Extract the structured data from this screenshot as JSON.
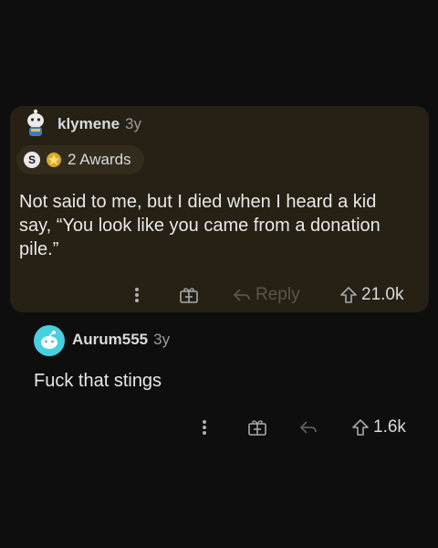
{
  "comments": [
    {
      "username": "klymene",
      "age": "3y",
      "awards_label": "2 Awards",
      "award_letter": "S",
      "body": "Not said to me, but I died when I heard a kid say, “You look like you came from a donation pile.”",
      "actions": {
        "reply_label": "Reply",
        "upvotes": "21.0k"
      },
      "icons": [
        "more-options-icon",
        "gift-award-icon",
        "reply-icon",
        "upvote-icon"
      ]
    },
    {
      "username": "Aurum555",
      "age": "3y",
      "body": "Fuck that stings",
      "actions": {
        "upvotes": "1.6k"
      },
      "icons": [
        "more-options-icon",
        "gift-award-icon",
        "reply-icon",
        "upvote-icon"
      ]
    }
  ],
  "colors": {
    "background": "#0e0e0e",
    "highlight_card": "#262114",
    "text_primary": "#e8e8e8",
    "text_muted": "#9a9a9a",
    "avatar_teal": "#46d0e0"
  }
}
